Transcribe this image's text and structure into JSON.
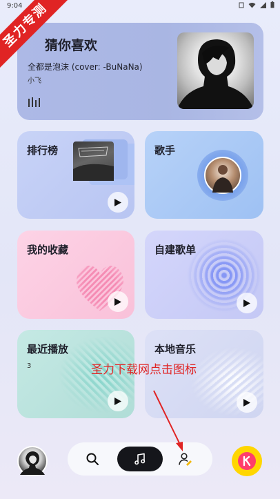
{
  "status_bar": {
    "time": "9:04"
  },
  "watermark": {
    "ribbon_text": "圣力专测",
    "overlay_text": "圣力下载网点击图标"
  },
  "hero": {
    "title": "猜你喜欢",
    "song": "全都是泡沫 (cover: -BuNaNa)",
    "artist": "小飞"
  },
  "tiles": {
    "chart": {
      "title": "排行榜"
    },
    "singer": {
      "title": "歌手"
    },
    "favorites": {
      "title": "我的收藏"
    },
    "playlist": {
      "title": "自建歌单"
    },
    "recent": {
      "title": "最近播放",
      "count": "3"
    },
    "local": {
      "title": "本地音乐"
    }
  },
  "nav": {
    "items": [
      "search-icon",
      "music-note-icon",
      "user-icon"
    ]
  },
  "colors": {
    "accent_yellow": "#ffd600",
    "watermark_red": "#e02424",
    "nav_active": "#15161b"
  }
}
